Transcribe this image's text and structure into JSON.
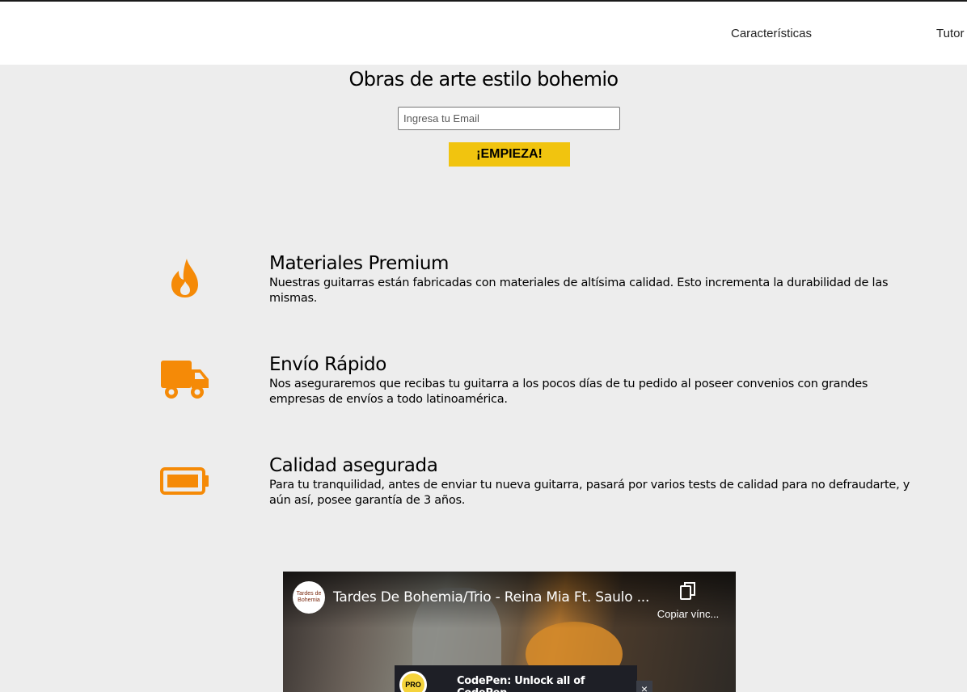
{
  "nav": {
    "links": [
      {
        "label": "Características"
      },
      {
        "label": "Tutor"
      }
    ]
  },
  "hero": {
    "title": "Obras de arte estilo bohemio",
    "email_placeholder": "Ingresa tu Email",
    "cta_label": "¡EMPIEZA!"
  },
  "features": [
    {
      "icon": "fire-icon",
      "title": "Materiales Premium",
      "text": "Nuestras guitarras están fabricadas con materiales de altísima calidad. Esto incrementa la durabilidad de las mismas."
    },
    {
      "icon": "truck-icon",
      "title": "Envío Rápido",
      "text": "Nos aseguraremos que recibas tu guitarra a los pocos días de tu pedido al poseer convenios con grandes empresas de envíos a todo latinoamérica."
    },
    {
      "icon": "battery-icon",
      "title": "Calidad asegurada",
      "text": "Para tu tranquilidad, antes de enviar tu nueva guitarra, pasará por varios tests de calidad para no defraudarte, y aún así, posee garantía de 3 años."
    }
  ],
  "video": {
    "title": "Tardes De Bohemia/Trio - Reina Mia Ft. Saulo ...",
    "copy_label": "Copiar vínc...",
    "channel_avatar_text": "Tardes de Bohemia"
  },
  "promo": {
    "badge": "PRO",
    "text": "CodePen: Unlock all of CodePen",
    "close": "×"
  },
  "colors": {
    "accent": "#f1c40f",
    "icon": "#f58a07",
    "background": "#ededed"
  }
}
